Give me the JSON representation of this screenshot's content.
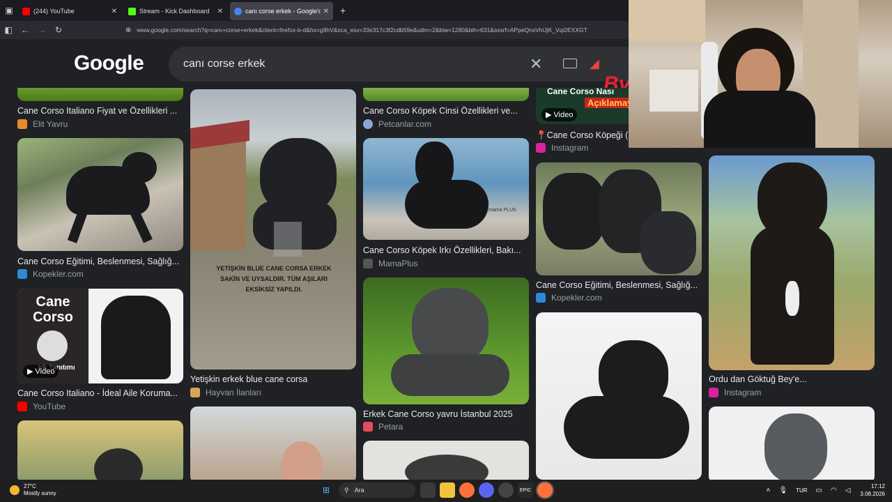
{
  "tabs": [
    {
      "title": "(244) YouTube",
      "color": "#ff0000"
    },
    {
      "title": "Stream - Kick Dashboard",
      "color": "#53fc18"
    },
    {
      "title": "canı corse erkek - Google'da Ar",
      "color": "#4285f4"
    }
  ],
  "url": "www.google.com/search?q=canı+corse+erkek&client=firefox-b-d&hs=g9hV&sca_esv=33e317c3f2cdb59e&udm=2&biw=1280&bih=631&sxsrf=APpeQnsVhiJjK_Vqi2EXXGT",
  "google": {
    "logo": "Google",
    "query": "canı corse erkek",
    "overlay": "By"
  },
  "results": {
    "col1": [
      {
        "caption": "Cane Corso Italiano Fiyat ve Özellikleri ...",
        "source": "Elit Yavru",
        "src_color": "#e88a2e"
      },
      {
        "caption": "Cane Corso Eğitimi, Beslenmesi, Sağlığ...",
        "source": "Kopekler.com",
        "src_color": "#2a8ad8"
      },
      {
        "caption": "Cane Corso Italiano - İdeal Aile Koruma...",
        "source": "YouTube",
        "src_color": "#ff0000",
        "badge": "Video",
        "thumb_title": "Cane Corso",
        "thumb_sub": "Irk Tanıtımı"
      }
    ],
    "col2": [
      {
        "caption": "Yetişkin erkek blue cane corsa",
        "source": "Hayvan İlanları",
        "src_color": "#d9a25a",
        "overlay_text": "YETİŞKİN BLUE CANE CORSA ERKEK SAKİN VE UYSALDIR. TÜM AŞILARI EKSİKSİZ YAPILDI."
      }
    ],
    "col3": [
      {
        "caption": "Cane Corso Köpek Cinsi Özellikleri ve...",
        "source": "Petcanlar.com",
        "src_color": "#8ea4d6"
      },
      {
        "caption": "Cane Corso Köpek Irkı Özellikleri, Bakı...",
        "source": "MamaPlus",
        "src_color": "#555555",
        "watermark": "mama PLUS"
      },
      {
        "caption": "Erkek Cane Corso yavru İstanbul 2025",
        "source": "Petara",
        "src_color": "#e84a5f"
      }
    ],
    "col4": [
      {
        "caption": "📍Cane Corso Köpeği (",
        "source": "Instagram",
        "src_color": "#d6249f",
        "badge": "Video",
        "thumb_title": "Cane Corso Nası",
        "thumb_sub": "Açıklamay"
      },
      {
        "caption": "Cane Corso Eğitimi, Beslenmesi, Sağlığ...",
        "source": "Kopekler.com",
        "src_color": "#2a8ad8"
      }
    ],
    "col5": [
      {
        "caption": "Ordu dan Göktuğ Bey'e...",
        "source": "Instagram",
        "src_color": "#d6249f"
      }
    ]
  },
  "taskbar": {
    "temp": "27°C",
    "weather": "Mostly sunny",
    "search": "Ara",
    "lang": "TUR",
    "time": "17:12",
    "date": "3.08.2026"
  },
  "icons": [
    "tab-list-icon",
    "back-icon",
    "forward-icon",
    "reload-icon",
    "lock-icon",
    "clear-icon",
    "keyboard-icon",
    "lens-icon",
    "windows-icon",
    "search-icon",
    "taskview-icon",
    "folder-icon",
    "firefox-icon",
    "discord-icon",
    "epic-icon",
    "chevron-up-icon",
    "mic-icon",
    "wifi-icon",
    "volume-icon"
  ]
}
